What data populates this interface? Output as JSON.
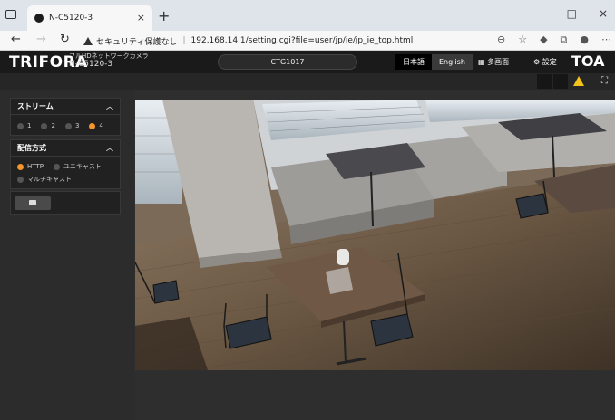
{
  "browser": {
    "tab_title": "N-C5120-3",
    "url_warning": "セキュリティ保護なし",
    "url": "192.168.14.1/setting.cgi?file=user/jp/ie/jp_ie_top.html"
  },
  "app": {
    "logo": "TRIFORA",
    "camera_type": "フルHDネットワークカメラ",
    "model": "N-C5120-3",
    "device_name": "CTG1017",
    "lang_ja": "日本語",
    "lang_en": "English",
    "multi_view": "多画面",
    "settings": "設定",
    "brand": "TOA"
  },
  "sidebar": {
    "stream": {
      "title": "ストリーム",
      "options": [
        "1",
        "2",
        "3",
        "4"
      ],
      "selected": "4"
    },
    "delivery": {
      "title": "配信方式",
      "http": "HTTP",
      "unicast": "ユニキャスト",
      "multicast": "マルチキャスト",
      "selected": "HTTP"
    }
  },
  "colors": {
    "accent": "#f3962c",
    "warning": "#f2c319"
  }
}
